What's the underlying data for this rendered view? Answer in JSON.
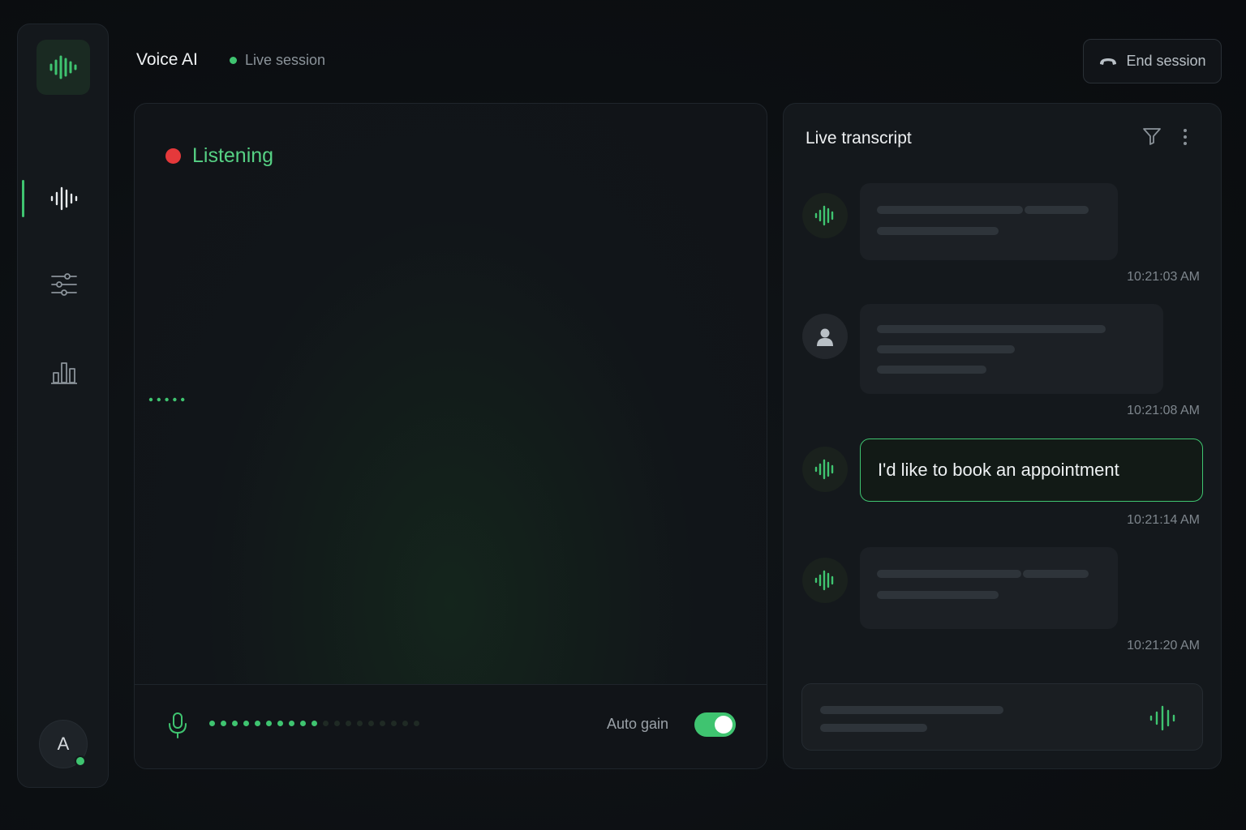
{
  "app": {
    "title": "Voice AI",
    "session_status": "Live session"
  },
  "header": {
    "end_session_label": "End session"
  },
  "sidebar": {
    "logo_icon": "waveform-icon",
    "items": [
      {
        "icon": "waveform-icon",
        "active": true
      },
      {
        "icon": "sliders-icon",
        "active": false
      },
      {
        "icon": "bar-chart-icon",
        "active": false
      }
    ],
    "user_initial": "A",
    "user_status": "online"
  },
  "visualizer": {
    "status": "Listening",
    "auto_gain_label": "Auto gain",
    "auto_gain_on": true,
    "input_level": 0.55
  },
  "transcript": {
    "title": "Live transcript",
    "messages": [
      {
        "speaker": "assistant",
        "text": "",
        "timestamp": "10:21:03 AM"
      },
      {
        "speaker": "user",
        "text": "",
        "timestamp": "10:21:08 AM"
      },
      {
        "speaker": "assistant",
        "text": "I'd like to book an appointment",
        "timestamp": "10:21:14 AM"
      },
      {
        "speaker": "assistant",
        "text": "",
        "timestamp": "10:21:20 AM"
      }
    ]
  },
  "colors": {
    "accent": "#3fc470",
    "record": "#e5393b",
    "background": "#0d1014"
  }
}
